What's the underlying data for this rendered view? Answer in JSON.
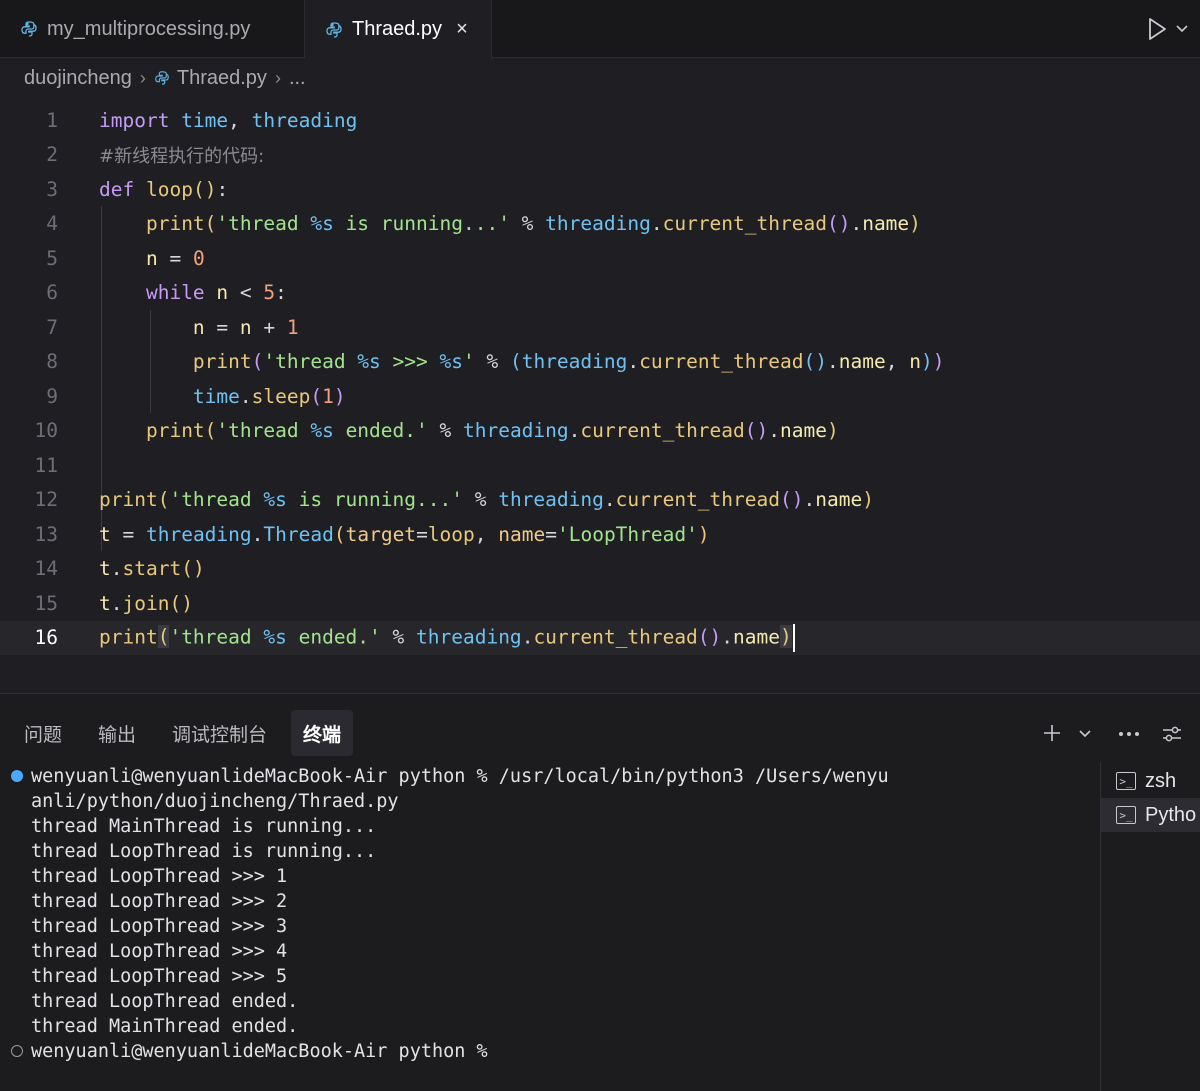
{
  "tabs": [
    {
      "label": "my_multiprocessing.py"
    },
    {
      "label": "Thraed.py",
      "close": "×"
    }
  ],
  "breadcrumb": {
    "folder": "duojincheng",
    "file": "Thraed.py",
    "more": "..."
  },
  "editor": {
    "active_line": 16,
    "lines": [
      {
        "n": "1"
      },
      {
        "n": "2"
      },
      {
        "n": "3"
      },
      {
        "n": "4"
      },
      {
        "n": "5"
      },
      {
        "n": "6"
      },
      {
        "n": "7"
      },
      {
        "n": "8"
      },
      {
        "n": "9"
      },
      {
        "n": "10"
      },
      {
        "n": "11"
      },
      {
        "n": "12"
      },
      {
        "n": "13"
      },
      {
        "n": "14"
      },
      {
        "n": "15"
      },
      {
        "n": "16"
      }
    ],
    "code": [
      "import time, threading",
      "#新线程执行的代码:",
      "def loop():",
      "    print('thread %s is running...' % threading.current_thread().name)",
      "    n = 0",
      "    while n < 5:",
      "        n = n + 1",
      "        print('thread %s >>> %s' % (threading.current_thread().name, n))",
      "        time.sleep(1)",
      "    print('thread %s ended.' % threading.current_thread().name)",
      "",
      "print('thread %s is running...' % threading.current_thread().name)",
      "t = threading.Thread(target=loop, name='LoopThread')",
      "t.start()",
      "t.join()",
      "print('thread %s ended.' % threading.current_thread().name)"
    ]
  },
  "panel": {
    "tabs": [
      "问题",
      "输出",
      "调试控制台",
      "终端"
    ],
    "selected_tab": "终端",
    "icons": [
      "plus-icon",
      "chevron-down-icon",
      "more-icon",
      "settings-icon"
    ]
  },
  "terminal": {
    "lines": [
      "wenyuanli@wenyuanlideMacBook-Air python % /usr/local/bin/python3 /Users/wenyu",
      "anli/python/duojincheng/Thraed.py",
      "thread MainThread is running...",
      "thread LoopThread is running...",
      "thread LoopThread >>> 1",
      "thread LoopThread >>> 2",
      "thread LoopThread >>> 3",
      "thread LoopThread >>> 4",
      "thread LoopThread >>> 5",
      "thread LoopThread ended.",
      "thread MainThread ended.",
      "wenyuanli@wenyuanlideMacBook-Air python %"
    ],
    "instances": [
      "zsh",
      "Pytho"
    ]
  },
  "colors": {
    "keyword": "#c49bf5",
    "function": "#e8c97a",
    "string": "#a3e38d",
    "module": "#6fc1f2",
    "number": "#f3a27c",
    "status_blue": "#4aa8ff"
  }
}
